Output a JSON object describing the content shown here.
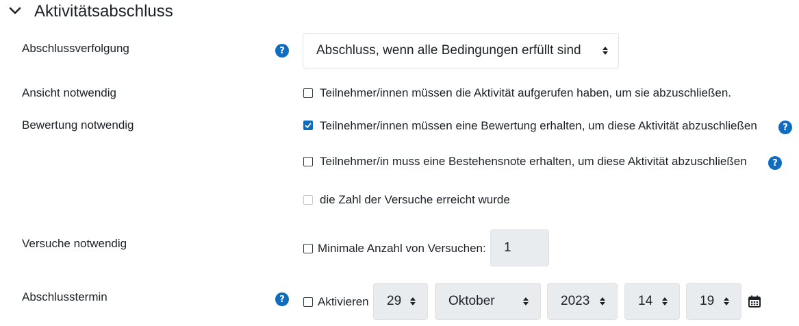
{
  "section": {
    "title": "Aktivitätsabschluss",
    "toggle_icon": "chevron-down-icon"
  },
  "completion_tracking": {
    "label": "Abschlussverfolgung",
    "selected": "Abschluss, wenn alle Bedingungen erfüllt sind"
  },
  "view_required": {
    "label": "Ansicht notwendig",
    "option": "Teilnehmer/innen müssen die Aktivität aufgerufen haben, um sie abzuschließen.",
    "checked": false
  },
  "grade_required": {
    "label": "Bewertung notwendig",
    "receive_grade": {
      "text": "Teilnehmer/innen müssen eine Bewertung erhalten, um diese Aktivität abzuschließen",
      "checked": true
    },
    "pass_grade": {
      "text": "Teilnehmer/in muss eine Bestehensnote erhalten, um diese Aktivität abzuschließen",
      "checked": false
    },
    "attempts_reached": {
      "text": "die Zahl der Versuche erreicht wurde",
      "checked": false,
      "disabled": true
    }
  },
  "attempts_required": {
    "label": "Versuche notwendig",
    "option": "Minimale Anzahl von Versuchen:",
    "value": "1",
    "checked": false
  },
  "completion_date": {
    "label": "Abschlusstermin",
    "enable_label": "Aktivieren",
    "enabled": false,
    "day": "29",
    "month": "Oktober",
    "year": "2023",
    "hour": "14",
    "minute": "19"
  },
  "help_icon_text": "?",
  "colors": {
    "accent": "#0f6cbf",
    "text": "#1d2125",
    "disabled_bg": "#e9ecef"
  }
}
